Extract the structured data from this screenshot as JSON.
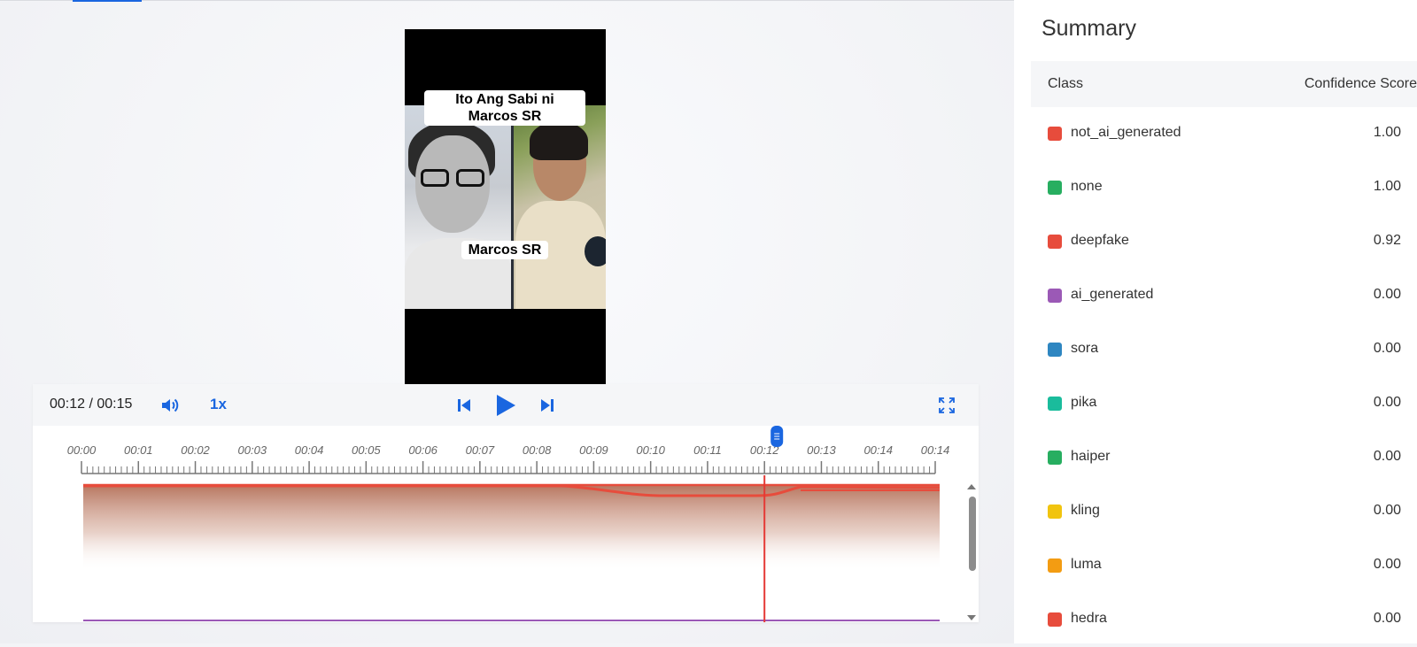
{
  "video": {
    "caption_top": "Ito Ang Sabi ni Marcos SR",
    "caption_bottom": "Marcos SR"
  },
  "player": {
    "time": "00:12 / 00:15",
    "speed": "1x",
    "progress_fraction": 0.8,
    "tick_labels": [
      "00:00",
      "00:01",
      "00:02",
      "00:03",
      "00:04",
      "00:05",
      "00:06",
      "00:07",
      "00:08",
      "00:09",
      "00:10",
      "00:11",
      "00:12",
      "00:13",
      "00:14",
      "00:14"
    ],
    "playhead_label_time": "00:12",
    "icons": {
      "volume": "volume-icon",
      "previous": "skip-previous-icon",
      "play": "play-icon",
      "next": "skip-next-icon",
      "fullscreen": "fullscreen-icon"
    }
  },
  "summary": {
    "title": "Summary",
    "header": {
      "class": "Class",
      "score": "Confidence Score"
    },
    "rows": [
      {
        "name": "not_ai_generated",
        "score": "1.00",
        "color": "#e74c3c"
      },
      {
        "name": "none",
        "score": "1.00",
        "color": "#27ae60"
      },
      {
        "name": "deepfake",
        "score": "0.92",
        "color": "#e74c3c"
      },
      {
        "name": "ai_generated",
        "score": "0.00",
        "color": "#9b59b6"
      },
      {
        "name": "sora",
        "score": "0.00",
        "color": "#2e86c1"
      },
      {
        "name": "pika",
        "score": "0.00",
        "color": "#1abc9c"
      },
      {
        "name": "haiper",
        "score": "0.00",
        "color": "#27ae60"
      },
      {
        "name": "kling",
        "score": "0.00",
        "color": "#f1c40f"
      },
      {
        "name": "luma",
        "score": "0.00",
        "color": "#f39c12"
      },
      {
        "name": "hedra",
        "score": "0.00",
        "color": "#e74c3c"
      }
    ]
  },
  "colors": {
    "accent": "#1a66e0",
    "playhead": "#e53935",
    "curve": "#e74c3c"
  }
}
